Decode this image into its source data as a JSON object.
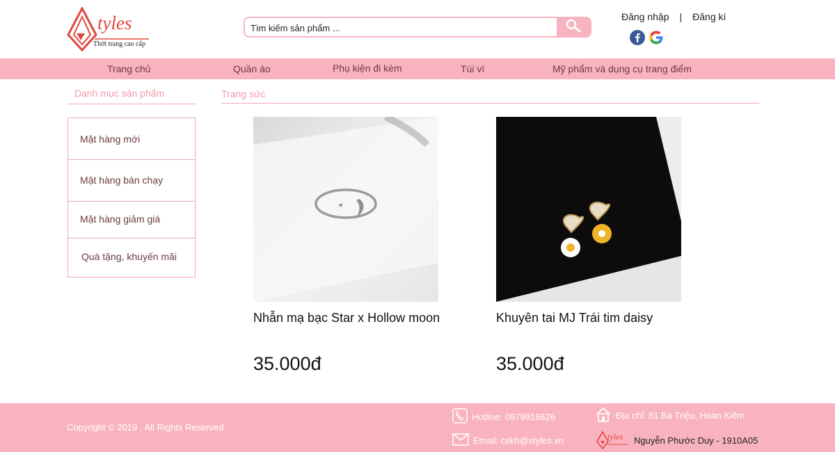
{
  "brand": {
    "logo_text": "tyles",
    "tagline": "Thời trang cao cấp"
  },
  "search": {
    "placeholder": "Tìm kiếm sản phẩm ..."
  },
  "auth": {
    "login": "Đăng nhập",
    "separator": "|",
    "register": "Đăng kí"
  },
  "social": {
    "facebook_icon": "facebook-icon",
    "google_icon": "google-icon"
  },
  "nav": {
    "items": [
      {
        "label": "Trang chủ"
      },
      {
        "label": "Quần áo"
      },
      {
        "label": "Phụ kiện đi kèm"
      },
      {
        "label": "Túi ví"
      },
      {
        "label": "Mỹ phẩm và dụng cụ trang điểm"
      }
    ]
  },
  "sidebar": {
    "title": "Danh mục sản phẩm",
    "items": [
      {
        "label": "Mặt hàng mới"
      },
      {
        "label": "Mặt hàng bán chạy"
      },
      {
        "label": "Mặt hàng giảm giá"
      },
      {
        "label": "Quà tặng, khuyến mãi"
      }
    ]
  },
  "main": {
    "section_title": "Trang sức",
    "products": [
      {
        "name": "Nhẫn mạ bạc Star x Hollow moon",
        "price": "35.000đ"
      },
      {
        "name": "Khuyên tai MJ Trái tim daisy",
        "price": "35.000đ"
      }
    ]
  },
  "footer": {
    "copyright": "Copyright © 2019 . All Rights Reserved",
    "hotline": "Hotline: 0979916626",
    "address": "Địa chỉ: 81 Bà Triệu, Hoàn Kiếm",
    "email": "Email: cskh@styles.vn",
    "author": "Nguyễn Phước Duy - 1910A05"
  },
  "colors": {
    "accent": "#f9b3be",
    "brand_red": "#e0463c",
    "text_dark": "#6b3b3f",
    "title_pink": "#f29aac"
  }
}
